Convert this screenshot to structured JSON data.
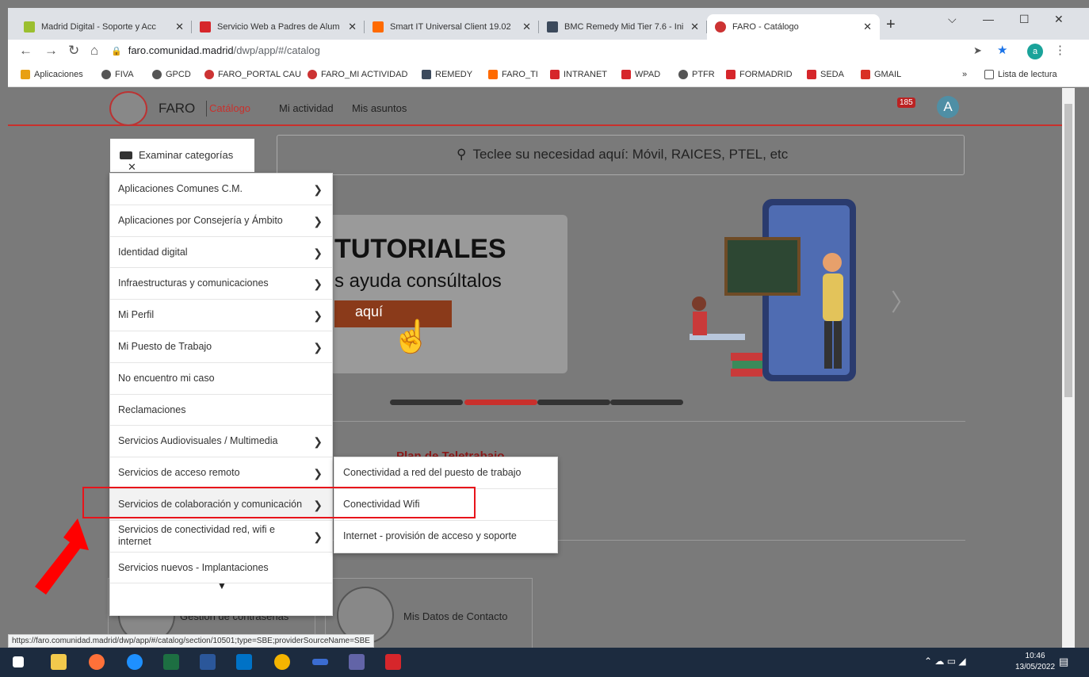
{
  "tabs": [
    {
      "title": "Madrid Digital - Soporte y Acc",
      "fav": "#9bbf2f"
    },
    {
      "title": "Servicio Web a Padres de Alum",
      "fav": "#d6262b"
    },
    {
      "title": "Smart IT Universal Client 19.02",
      "fav": "#ff6a00"
    },
    {
      "title": "BMC Remedy Mid Tier 7.6 - Ini",
      "fav": "#3c4a5c"
    },
    {
      "title": "FARO - Catálogo",
      "fav": "#cc3333"
    }
  ],
  "toolbar": {
    "host": "faro.comunidad.madrid",
    "path": "/dwp/app/#/catalog",
    "profile": "a"
  },
  "bookmarks": [
    {
      "label": "Aplicaciones",
      "color": "#e8a013"
    },
    {
      "label": "FIVA",
      "color": "#555555"
    },
    {
      "label": "GPCD",
      "color": "#555555"
    },
    {
      "label": "FARO_PORTAL CAU",
      "color": "#cc3333"
    },
    {
      "label": "FARO_MI ACTIVIDAD",
      "color": "#cc3333"
    },
    {
      "label": "REMEDY",
      "color": "#3c4a5c"
    },
    {
      "label": "FARO_TI",
      "color": "#ff6a00"
    },
    {
      "label": "INTRANET",
      "color": "#d6262b"
    },
    {
      "label": "WPAD",
      "color": "#d6262b"
    },
    {
      "label": "PTFR",
      "color": "#555555"
    },
    {
      "label": "FORMADRID",
      "color": "#d6262b"
    },
    {
      "label": "SEDA",
      "color": "#d6262b"
    },
    {
      "label": "GMAIL",
      "color": "#d93025"
    }
  ],
  "reading_list": "Lista de lectura",
  "faro": {
    "brand": "FARO",
    "nav": [
      "Catálogo",
      "Mi actividad",
      "Mis asuntos"
    ],
    "notifications": "185",
    "avatar": "A",
    "browse_label": "Examinar categorías",
    "search_placeholder": "Teclee su necesidad aquí: Móvil, RAICES, PTEL, etc"
  },
  "banner": {
    "title": "TUTORIALES",
    "subtitle": "s ayuda consúltalos",
    "cta": "aquí"
  },
  "partial_heading": "Plan de Teletrabajo",
  "cards": [
    "Gestión de contraseñas",
    "Mis Datos de Contacto"
  ],
  "categories": [
    {
      "label": "Aplicaciones Comunes C.M.",
      "sub": true
    },
    {
      "label": "Aplicaciones por Consejería y Ámbito",
      "sub": true
    },
    {
      "label": "Identidad digital",
      "sub": true
    },
    {
      "label": "Infraestructuras y comunicaciones",
      "sub": true
    },
    {
      "label": "Mi Perfil",
      "sub": true
    },
    {
      "label": "Mi Puesto de Trabajo",
      "sub": true
    },
    {
      "label": "No encuentro mi caso",
      "sub": false
    },
    {
      "label": "Reclamaciones",
      "sub": false
    },
    {
      "label": "Servicios Audiovisuales / Multimedia",
      "sub": true
    },
    {
      "label": "Servicios de acceso remoto",
      "sub": true
    },
    {
      "label": "Servicios de colaboración y comunicación",
      "sub": true
    },
    {
      "label": "Servicios de conectividad red, wifi e internet",
      "sub": true
    },
    {
      "label": "Servicios nuevos - Implantaciones",
      "sub": false
    }
  ],
  "subcategories": [
    "Conectividad a red del puesto de trabajo",
    "Conectividad Wifi",
    "Internet - provisión de acceso y soporte"
  ],
  "status_url": "https://faro.comunidad.madrid/dwp/app/#/catalog/section/10501;type=SBE;providerSourceName=SBE",
  "clock": {
    "time": "10:46",
    "date": "13/05/2022"
  }
}
